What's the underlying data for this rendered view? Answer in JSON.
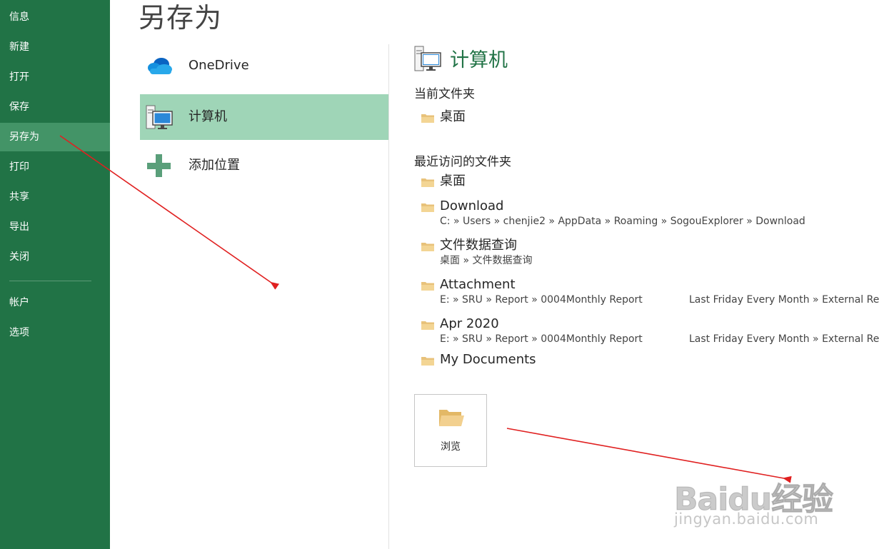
{
  "nav": {
    "items": [
      {
        "label": "信息"
      },
      {
        "label": "新建"
      },
      {
        "label": "打开"
      },
      {
        "label": "保存"
      },
      {
        "label": "另存为",
        "active": true
      },
      {
        "label": "打印"
      },
      {
        "label": "共享"
      },
      {
        "label": "导出"
      },
      {
        "label": "关闭"
      },
      {
        "label": "帐户"
      },
      {
        "label": "选项"
      }
    ]
  },
  "page_title": "另存为",
  "locations": [
    {
      "label": "OneDrive",
      "icon": "onedrive-cloud-icon"
    },
    {
      "label": "计算机",
      "icon": "computer-icon",
      "selected": true
    },
    {
      "label": "添加位置",
      "icon": "plus-icon"
    }
  ],
  "right_panel": {
    "heading": "计算机",
    "current_folder_label": "当前文件夹",
    "current_folder": {
      "name": "桌面"
    },
    "recent_label": "最近访问的文件夹",
    "recent": [
      {
        "name": "桌面",
        "path": "",
        "path_extra": ""
      },
      {
        "name": "Download",
        "path": "C: » Users » chenjie2 » AppData » Roaming » SogouExplorer » Download",
        "path_extra": ""
      },
      {
        "name": "文件数据查询",
        "path": "桌面 » 文件数据查询",
        "path_extra": ""
      },
      {
        "name": "Attachment",
        "path": "E: » SRU » Report » 0004Monthly Report",
        "path_extra": "Last Friday Every Month » External Re"
      },
      {
        "name": "Apr 2020",
        "path": "E: » SRU » Report » 0004Monthly Report",
        "path_extra": "Last Friday Every Month » External Re"
      },
      {
        "name": "My Documents",
        "path": "",
        "path_extra": ""
      }
    ],
    "browse_label": "浏览"
  },
  "watermark": {
    "brand": "Baidu经验",
    "url": "jingyan.baidu.com"
  },
  "colors": {
    "nav_bg": "#217346",
    "nav_active": "#439467",
    "selected_location": "#9fd5b7",
    "accent": "#217346",
    "annotation_arrow": "#e02020",
    "folder": "#e8c27a"
  }
}
